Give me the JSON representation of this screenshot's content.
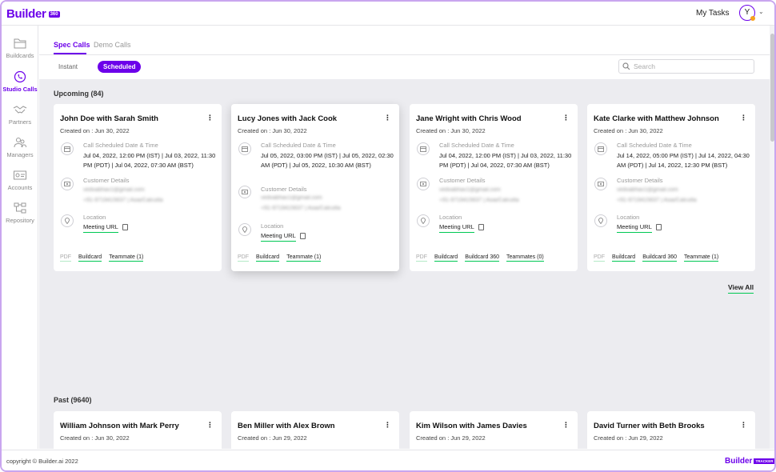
{
  "header": {
    "logo_text": "Builder",
    "logo_badge": "360",
    "my_tasks": "My Tasks",
    "avatar_initial": "Y",
    "brand_color": "#6c00ea",
    "status_dot_color": "#f7a21b"
  },
  "sidebar": {
    "items": [
      {
        "label": "Buildcards",
        "icon": "folder-icon"
      },
      {
        "label": "Studio Calls",
        "icon": "phone-icon",
        "active": true
      },
      {
        "label": "Partners",
        "icon": "handshake-icon"
      },
      {
        "label": "Managers",
        "icon": "people-icon"
      },
      {
        "label": "Accounts",
        "icon": "id-card-icon"
      },
      {
        "label": "Repository",
        "icon": "tree-icon"
      }
    ]
  },
  "tabs": [
    {
      "label": "Spec Calls",
      "active": true
    },
    {
      "label": "Demo Calls",
      "active": false
    }
  ],
  "filters": {
    "instant": "Instant",
    "scheduled": "Scheduled",
    "search_placeholder": "Search"
  },
  "upcoming": {
    "title": "Upcoming (84)",
    "view_all": "View All",
    "cards": [
      {
        "title": "John Doe with Sarah Smith",
        "created": "Created on : Jun 30, 2022",
        "schedule_label": "Call Scheduled Date & Time",
        "schedule_value": "Jul 04, 2022, 12:00 PM (IST)  |  Jul 03, 2022, 11:30 PM (PDT)  |  Jul 04, 2022, 07:30 AM (BST)",
        "customer_label": "Customer Details",
        "customer_email": "vedvabhav1@gmail.com",
        "customer_phone": "+91-9719415637  |  Asia/Calcutta",
        "location_label": "Location",
        "meeting_url": "Meeting URL",
        "links": [
          "PDF",
          "Buildcard",
          "Teammate (1)"
        ]
      },
      {
        "title": "Lucy Jones with Jack Cook",
        "created": "Created on : Jun 30, 2022",
        "schedule_label": "Call Scheduled Date & Time",
        "schedule_value": "Jul 05, 2022, 03:00 PM (IST)  |  Jul 05, 2022, 02:30 AM (PDT)  |  Jul 05, 2022, 10:30 AM (BST)",
        "customer_label": "Customer Details",
        "customer_email": "vedvabhav1@gmail.com",
        "customer_phone": "+91-9719415637  |  Asia/Calcutta",
        "location_label": "Location",
        "meeting_url": "Meeting URL",
        "links": [
          "PDF",
          "Buildcard",
          "Teammate (1)"
        ]
      },
      {
        "title": "Jane Wright with Chris Wood",
        "created": "Created on : Jun 30, 2022",
        "schedule_label": "Call Scheduled Date & Time",
        "schedule_value": "Jul 04, 2022, 12:00 PM (IST)  |  Jul 03, 2022, 11:30 PM (PDT)  |  Jul 04, 2022, 07:30 AM (BST)",
        "customer_label": "Customer Details",
        "customer_email": "vedvabhav1@gmail.com",
        "customer_phone": "+91-9719415637  |  Asia/Calcutta",
        "location_label": "Location",
        "meeting_url": "Meeting URL",
        "links": [
          "PDF",
          "Buildcard",
          "Buildcard 360",
          "Teammates (0)"
        ]
      },
      {
        "title": "Kate Clarke with Matthew Johnson",
        "created": "Created on : Jun 30, 2022",
        "schedule_label": "Call Scheduled Date & Time",
        "schedule_value": "Jul 14, 2022, 05:00 PM (IST)  |  Jul 14, 2022, 04:30 AM (PDT)  |  Jul 14, 2022, 12:30 PM (BST)",
        "customer_label": "Customer Details",
        "customer_email": "vedvabhav1@gmail.com",
        "customer_phone": "+91-9719415637  |  Asia/Calcutta",
        "location_label": "Location",
        "meeting_url": "Meeting URL",
        "links": [
          "PDF",
          "Buildcard",
          "Buildcard 360",
          "Teammate (1)"
        ]
      }
    ]
  },
  "past": {
    "title": "Past (9640)",
    "cards": [
      {
        "title": "William Johnson with Mark Perry",
        "created": "Created on : Jun 30, 2022"
      },
      {
        "title": "Ben Miller with Alex Brown",
        "created": "Created on : Jun 29, 2022"
      },
      {
        "title": "Kim Wilson with James Davies",
        "created": "Created on : Jun 29, 2022"
      },
      {
        "title": "David Turner with Beth Brooks",
        "created": "Created on : Jun 29, 2022"
      }
    ]
  },
  "footer": {
    "copyright": "copyright © Builder.ai 2022",
    "logo_text": "Builder",
    "logo_badge": "TRACKER"
  }
}
